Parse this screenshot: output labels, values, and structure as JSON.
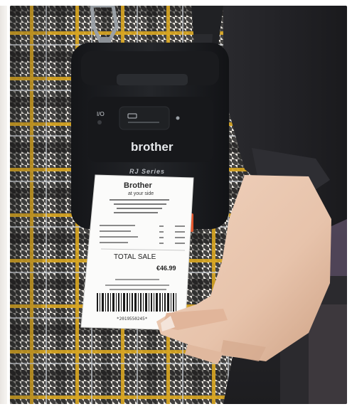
{
  "printer": {
    "brand": "brother",
    "series": "RJ Series",
    "power_label": "I/O"
  },
  "receipt": {
    "shop_name": "Brother",
    "tagline": "at your side",
    "total_label": "TOTAL SALE",
    "total_value": "€46.99",
    "barcode_number": "*2019550245*"
  },
  "colors": {
    "printer_body": "#1c1d20",
    "fabric_base": "#e8e4dd",
    "fabric_dark": "#1a1a1a",
    "fabric_yellow": "#d9a520",
    "sleeve": "#232326",
    "skin": "#e7c3ab",
    "accent_orange": "#e4572e"
  }
}
